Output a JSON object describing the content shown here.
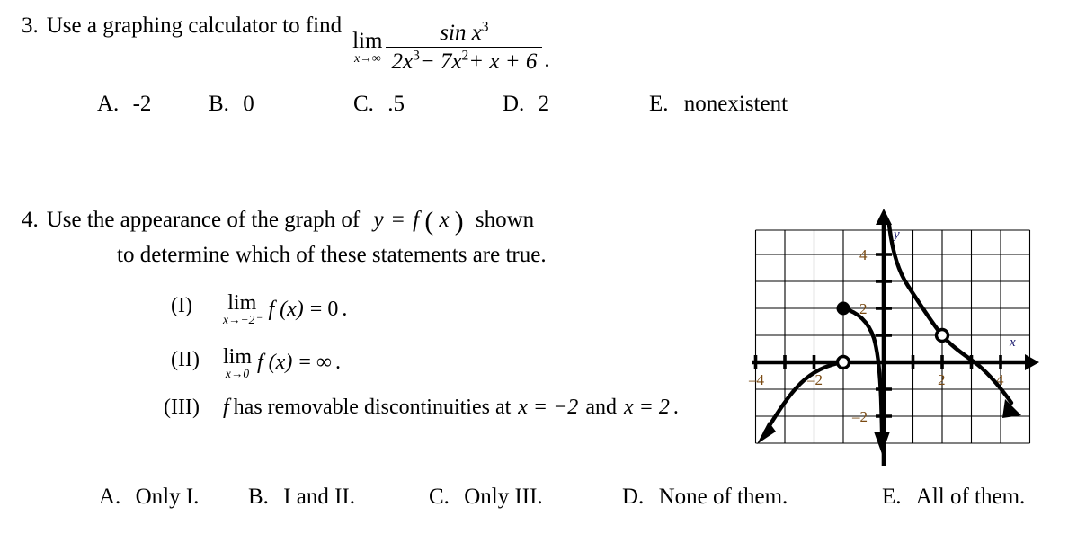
{
  "questions": [
    {
      "number": "3.",
      "prompt": "Use a graphing calculator to find",
      "lim_word": "lim",
      "lim_sub": "x→∞",
      "numerator": "sin x",
      "numerator_exp": "3",
      "denominator_a": "2x",
      "denominator_a_exp": "3",
      "denominator_b": "− 7x",
      "denominator_b_exp": "2",
      "denominator_c": "+ x + 6",
      "period": ".",
      "options": [
        {
          "label": "A.",
          "text": "-2"
        },
        {
          "label": "B.",
          "text": "0"
        },
        {
          "label": "C.",
          "text": ".5"
        },
        {
          "label": "D.",
          "text": "2"
        },
        {
          "label": "E.",
          "text": "nonexistent"
        }
      ]
    },
    {
      "number": "4.",
      "prompt_part1": "Use the appearance of the graph of",
      "prompt_eq_y": "y",
      "prompt_eq_equals": "=",
      "prompt_eq_f": "f",
      "prompt_eq_open": "(",
      "prompt_eq_x": "x",
      "prompt_eq_close": ")",
      "prompt_part2": "shown",
      "prompt_line2": "to determine which of these statements are true.",
      "statements": [
        {
          "label": "(I)",
          "lim_word": "lim",
          "lim_sub": "x→−2⁻",
          "fx": "f (x)",
          "equals": "= 0",
          "period": "."
        },
        {
          "label": "(II)",
          "lim_word": "lim",
          "lim_sub": "x→0",
          "fx": "f (x)",
          "equals": "= ∞",
          "period": "."
        },
        {
          "label": "(III)",
          "text_f": "f",
          "text_rest": "has removable discontinuities at",
          "cond1": "x = −2",
          "and_word": "and",
          "cond2": "x = 2",
          "period": "."
        }
      ],
      "options": [
        {
          "label": "A.",
          "text": "Only I."
        },
        {
          "label": "B.",
          "text": "I and II."
        },
        {
          "label": "C.",
          "text": "Only III."
        },
        {
          "label": "D.",
          "text": "None of them."
        },
        {
          "label": "E.",
          "text": "All of them."
        }
      ]
    }
  ],
  "chart_data": {
    "type": "line",
    "title": "",
    "xlabel": "x",
    "ylabel": "y",
    "xlim": [
      -4.6,
      4.9
    ],
    "ylim": [
      -2.9,
      5.0
    ],
    "grid": true,
    "grid_spacing": 1,
    "x_tick_labels": [
      "–4",
      "–2",
      "2",
      "4"
    ],
    "x_tick_values": [
      -4,
      -2,
      2,
      4
    ],
    "y_tick_labels": [
      "4",
      "2",
      "–2"
    ],
    "y_tick_values": [
      4,
      2,
      -2
    ],
    "axis_arrow_labels": {
      "x_axis": "x",
      "y_axis": "y"
    },
    "branches": [
      {
        "name": "left-lower-branch",
        "description": "rises from lower-left arrow to open circle at (-2, 0)",
        "points": [
          [
            -4.35,
            -2.6
          ],
          [
            -4.0,
            -1.9
          ],
          [
            -3.4,
            -1.1
          ],
          [
            -2.8,
            -0.5
          ],
          [
            -2.3,
            -0.13
          ],
          [
            -2.0,
            0
          ]
        ],
        "start_arrow": true,
        "end_arrow": false
      },
      {
        "name": "middle-branch",
        "description": "starts at filled dot (-2, 2), decreases to -infinity as x approaches 0 from the left",
        "points": [
          [
            -2.0,
            2.0
          ],
          [
            -1.6,
            1.72
          ],
          [
            -1.2,
            1.3
          ],
          [
            -0.85,
            0.72
          ],
          [
            -0.6,
            0.05
          ],
          [
            -0.42,
            -0.85
          ],
          [
            -0.33,
            -1.7
          ],
          [
            -0.28,
            -2.6
          ]
        ],
        "start_arrow": false,
        "end_arrow": true
      },
      {
        "name": "right-branch",
        "description": "descends from +infinity near x=0+, through open circle at (2, 1), crosses x-axis near x=3, to lower-right arrow",
        "points": [
          [
            0.18,
            5.0
          ],
          [
            0.32,
            4.0
          ],
          [
            0.55,
            3.1
          ],
          [
            0.95,
            2.3
          ],
          [
            1.45,
            1.5
          ],
          [
            2.0,
            1.0
          ],
          [
            2.5,
            0.72
          ],
          [
            3.0,
            0.1
          ],
          [
            3.6,
            -0.9
          ],
          [
            4.25,
            -1.85
          ]
        ],
        "start_arrow": false,
        "end_arrow": true
      }
    ],
    "filled_points": [
      {
        "x": -2,
        "y": 2
      }
    ],
    "open_points": [
      {
        "x": -2,
        "y": 0
      },
      {
        "x": 2,
        "y": 1
      }
    ]
  }
}
